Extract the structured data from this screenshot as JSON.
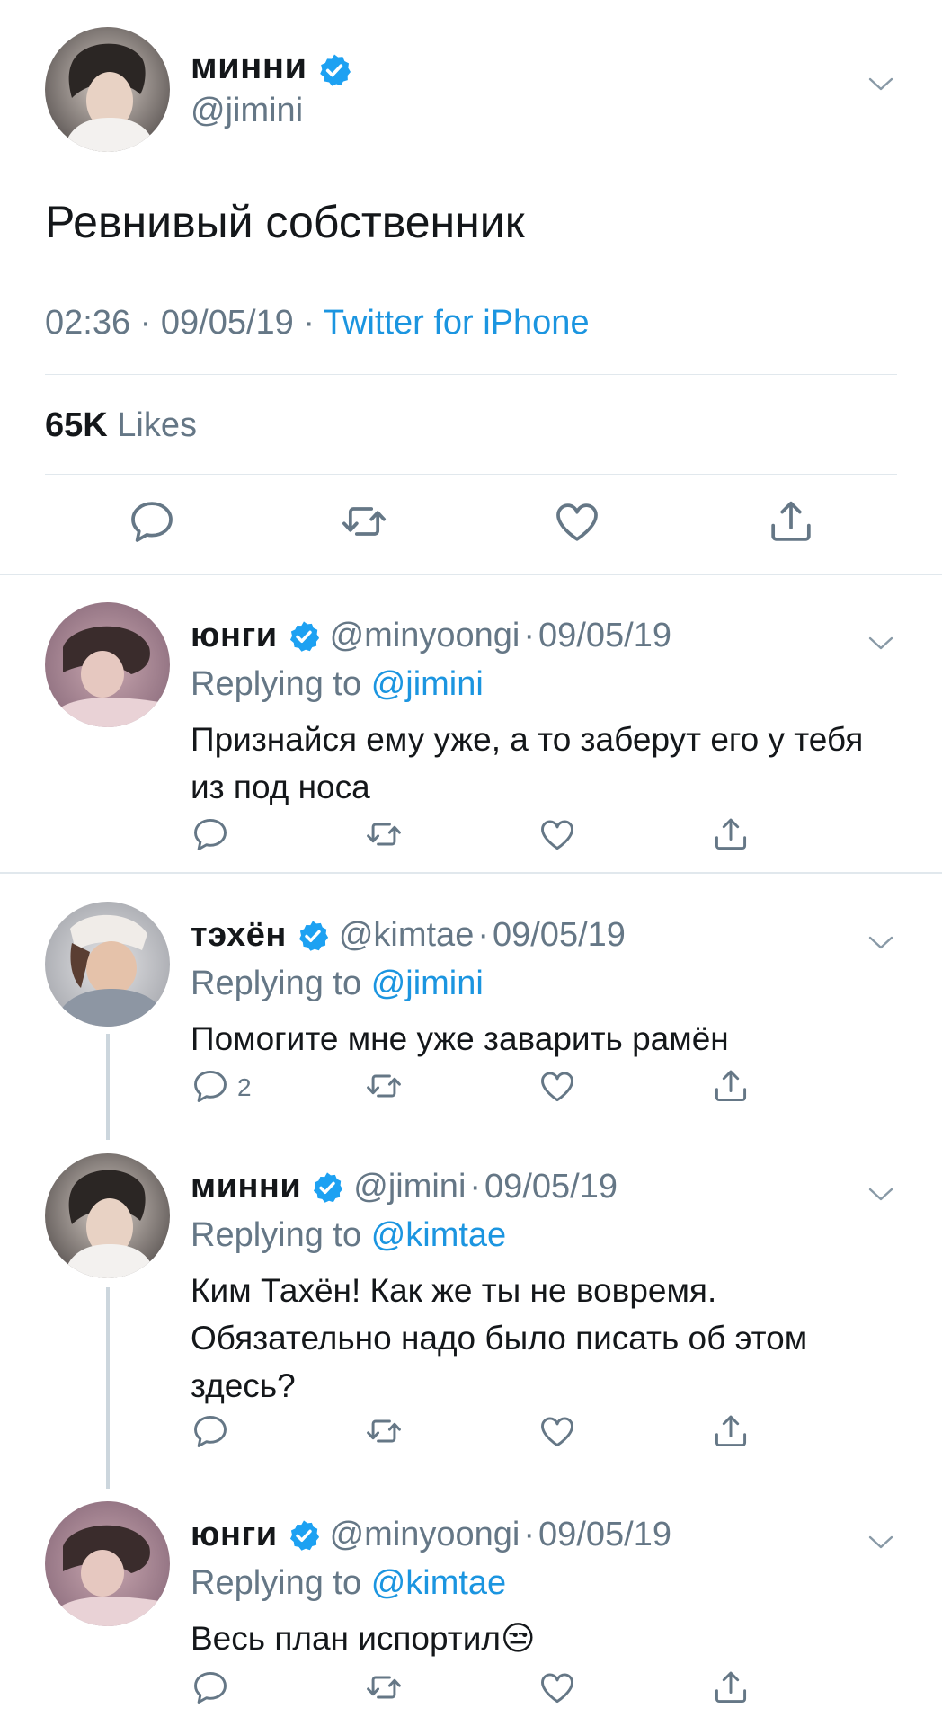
{
  "main_tweet": {
    "author": {
      "name": "минни",
      "handle": "@jimini",
      "verified": true
    },
    "text": "Ревнивый собственник",
    "time": "02:36",
    "date": "09/05/19",
    "source": "Twitter for iPhone",
    "likes_count": "65K",
    "likes_label": "Likes",
    "icons": {
      "reply": "reply-icon",
      "retweet": "retweet-icon",
      "like": "heart-icon",
      "share": "share-icon",
      "menu": "chevron-down-icon"
    }
  },
  "replies": [
    {
      "name": "юнги",
      "handle": "@minyoongi",
      "date": "09/05/19",
      "replying_label": "Replying to",
      "replying_to": "@jimini",
      "text": "Признайся ему уже, а то заберут его у тебя из под носа",
      "reply_count": ""
    },
    {
      "name": "тэхён",
      "handle": "@kimtae",
      "date": "09/05/19",
      "replying_label": "Replying to",
      "replying_to": "@jimini",
      "text": "Помогите мне уже заварить рамён",
      "reply_count": "2"
    },
    {
      "name": "минни",
      "handle": "@jimini",
      "date": "09/05/19",
      "replying_label": "Replying to",
      "replying_to": "@kimtae",
      "text": "Ким Тахён! Как же ты не вовремя. Обязательно надо было писать об этом здесь?",
      "reply_count": ""
    },
    {
      "name": "юнги",
      "handle": "@minyoongi",
      "date": "09/05/19",
      "replying_label": "Replying to",
      "replying_to": "@kimtae",
      "text": "Весь план испортил😒",
      "reply_count": ""
    }
  ],
  "colors": {
    "text": "#14171a",
    "secondary": "#657786",
    "link": "#1b95e0",
    "divider": "#e1e8ed",
    "verified": "#1da1f2"
  }
}
